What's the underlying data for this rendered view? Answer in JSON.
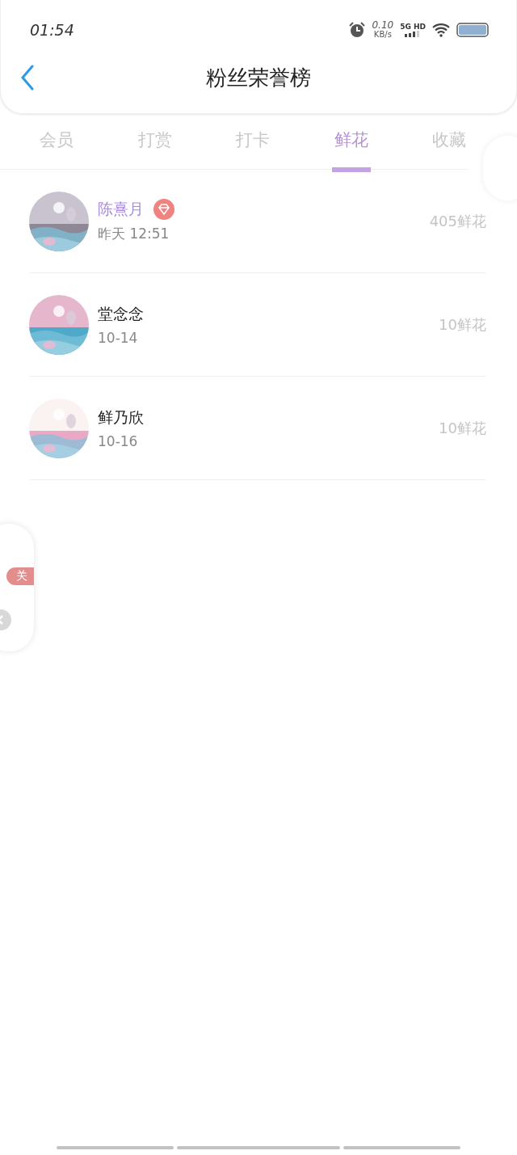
{
  "status_bar": {
    "time": "01:54",
    "speed": "0.10",
    "speed_unit": "KB/s",
    "network": "5G HD"
  },
  "header": {
    "title": "粉丝荣誉榜"
  },
  "tabs": [
    {
      "label": "会员",
      "selected": false
    },
    {
      "label": "打赏",
      "selected": false
    },
    {
      "label": "打卡",
      "selected": false
    },
    {
      "label": "鲜花",
      "selected": true
    },
    {
      "label": "收藏",
      "selected": false
    }
  ],
  "fans": [
    {
      "name": "陈熹月",
      "vip": true,
      "time": "昨天 12:51",
      "amount": "405鲜花"
    },
    {
      "name": "堂念念",
      "vip": false,
      "time": "10-14",
      "amount": "10鲜花"
    },
    {
      "name": "鲜乃欣",
      "vip": false,
      "time": "10-16",
      "amount": "10鲜花"
    }
  ],
  "float_panel": {
    "close_label": "关"
  }
}
